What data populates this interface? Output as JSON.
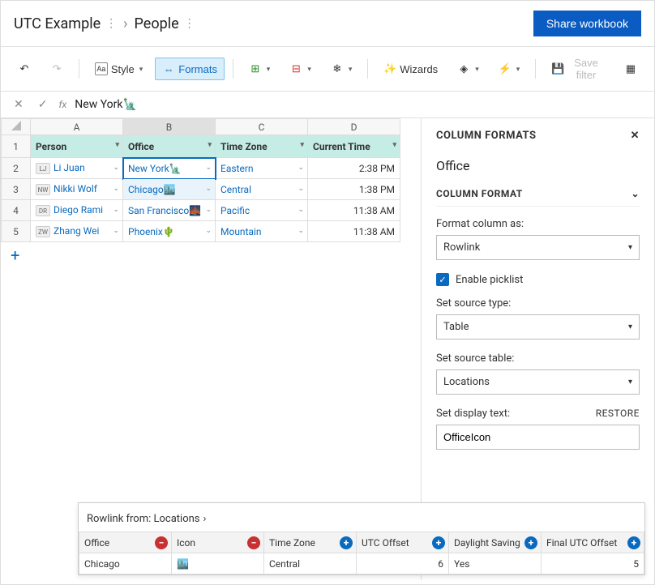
{
  "breadcrumb": {
    "a": "UTC Example",
    "b": "People"
  },
  "share": "Share workbook",
  "toolbar": {
    "style": "Style",
    "formats": "Formats",
    "wizards": "Wizards",
    "savefilter": "Save filter"
  },
  "formula": {
    "value": "New York🗽"
  },
  "cols": {
    "a": "A",
    "b": "B",
    "c": "C",
    "d": "D"
  },
  "headers": {
    "person": "Person",
    "office": "Office",
    "tz": "Time Zone",
    "ct": "Current Time"
  },
  "rows": [
    {
      "n": "1"
    },
    {
      "n": "2",
      "pi": "LJ",
      "p": "Li Juan",
      "o": "New York🗽",
      "tz": "Eastern",
      "t": "2:38 PM"
    },
    {
      "n": "3",
      "pi": "NW",
      "p": "Nikki Wolf",
      "o": "Chicago🏙️",
      "tz": "Central",
      "t": "1:38 PM"
    },
    {
      "n": "4",
      "pi": "DR",
      "p": "Diego Rami",
      "o": "San Francisco🌉",
      "tz": "Pacific",
      "t": "11:38 AM"
    },
    {
      "n": "5",
      "pi": "ZW",
      "p": "Zhang Wei",
      "o": "Phoenix🌵",
      "tz": "Mountain",
      "t": "11:38 AM"
    }
  ],
  "panel": {
    "title": "COLUMN FORMATS",
    "col": "Office",
    "sec": "COLUMN FORMAT",
    "fmt_label": "Format column as:",
    "fmt_value": "Rowlink",
    "enable": "Enable picklist",
    "src_type_label": "Set source type:",
    "src_type": "Table",
    "src_table_label": "Set source table:",
    "src_table": "Locations",
    "disp_label": "Set display text:",
    "restore": "RESTORE",
    "disp_value": "OfficeIcon"
  },
  "rowlink": {
    "title": "Rowlink from: Locations",
    "hdr": {
      "office": "Office",
      "icon": "Icon",
      "tz": "Time Zone",
      "utc": "UTC Offset",
      "dst": "Daylight Saving",
      "futc": "Final UTC Offset"
    },
    "row": {
      "office": "Chicago",
      "icon": "🏙️",
      "tz": "Central",
      "utc": "6",
      "dst": "Yes",
      "futc": "5"
    }
  },
  "chart_data": {
    "type": "table",
    "title": "People",
    "columns": [
      "Person",
      "Office",
      "Time Zone",
      "Current Time"
    ],
    "rows": [
      [
        "Li Juan",
        "New York",
        "Eastern",
        "2:38 PM"
      ],
      [
        "Nikki Wolf",
        "Chicago",
        "Central",
        "1:38 PM"
      ],
      [
        "Diego Rami",
        "San Francisco",
        "Pacific",
        "11:38 AM"
      ],
      [
        "Zhang Wei",
        "Phoenix",
        "Mountain",
        "11:38 AM"
      ]
    ]
  }
}
